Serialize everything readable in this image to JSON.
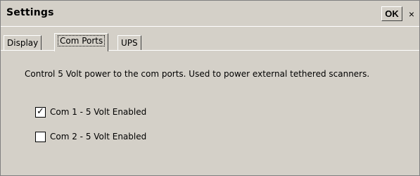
{
  "window": {
    "title": "Settings",
    "ok_label": "OK",
    "close_label": "×"
  },
  "tabs": [
    {
      "label": "Display",
      "active": false
    },
    {
      "label": "Com Ports",
      "active": true
    },
    {
      "label": "UPS",
      "active": false
    }
  ],
  "content": {
    "description": "Control 5 Volt power to the com ports. Used to power external tethered scanners.",
    "options": [
      {
        "label": "Com 1 - 5 Volt Enabled",
        "checked": true,
        "mark": "✓"
      },
      {
        "label": "Com 2 - 5 Volt Enabled",
        "checked": false,
        "mark": ""
      }
    ]
  }
}
